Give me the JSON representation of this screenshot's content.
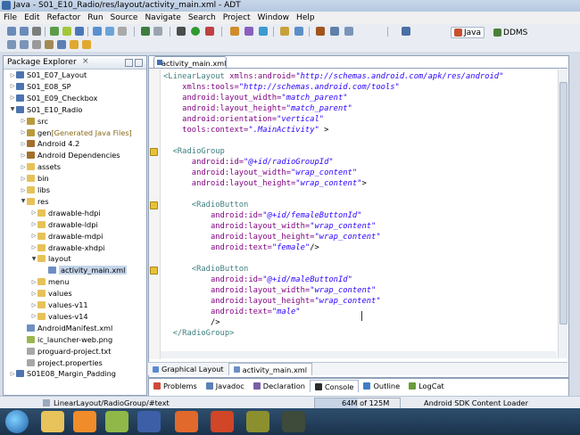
{
  "window": {
    "title": "Java - S01_E10_Radio/res/layout/activity_main.xml - ADT"
  },
  "menu": [
    "File",
    "Edit",
    "Refactor",
    "Run",
    "Source",
    "Navigate",
    "Search",
    "Project",
    "Window",
    "Help"
  ],
  "perspectives": [
    {
      "label": "Java",
      "icon": "java-perspective-icon",
      "active": true
    },
    {
      "label": "DDMS",
      "icon": "ddms-perspective-icon",
      "active": false
    }
  ],
  "package_explorer": {
    "title": "Package Explorer",
    "items": [
      {
        "label": "S01_E07_Layout",
        "icon": "project-icon",
        "expanded": false,
        "level": 0
      },
      {
        "label": "S01_E08_SP",
        "icon": "project-icon",
        "expanded": false,
        "level": 0
      },
      {
        "label": "S01_E09_Checkbox",
        "icon": "project-icon",
        "expanded": false,
        "level": 0
      },
      {
        "label": "S01_E10_Radio",
        "icon": "project-icon",
        "expanded": true,
        "level": 0
      },
      {
        "label": "src",
        "icon": "source-folder-icon",
        "expanded": false,
        "level": 1
      },
      {
        "label": "gen",
        "suffix": "[Generated Java Files]",
        "icon": "source-folder-icon",
        "expanded": false,
        "level": 1
      },
      {
        "label": "Android 4.2",
        "icon": "library-icon",
        "expanded": false,
        "level": 1
      },
      {
        "label": "Android Dependencies",
        "icon": "library-icon",
        "expanded": false,
        "level": 1
      },
      {
        "label": "assets",
        "icon": "folder-icon",
        "expanded": false,
        "level": 1
      },
      {
        "label": "bin",
        "icon": "folder-icon",
        "expanded": false,
        "level": 1
      },
      {
        "label": "libs",
        "icon": "folder-icon",
        "expanded": false,
        "level": 1
      },
      {
        "label": "res",
        "icon": "folder-icon",
        "expanded": true,
        "level": 1
      },
      {
        "label": "drawable-hdpi",
        "icon": "folder-icon",
        "expanded": false,
        "level": 2
      },
      {
        "label": "drawable-ldpi",
        "icon": "folder-icon",
        "expanded": false,
        "level": 2
      },
      {
        "label": "drawable-mdpi",
        "icon": "folder-icon",
        "expanded": false,
        "level": 2
      },
      {
        "label": "drawable-xhdpi",
        "icon": "folder-icon",
        "expanded": false,
        "level": 2
      },
      {
        "label": "layout",
        "icon": "folder-icon",
        "expanded": true,
        "level": 2
      },
      {
        "label": "activity_main.xml",
        "icon": "xml-file-icon",
        "expanded": null,
        "level": 3,
        "selected": true
      },
      {
        "label": "menu",
        "icon": "folder-icon",
        "expanded": false,
        "level": 2
      },
      {
        "label": "values",
        "icon": "folder-icon",
        "expanded": false,
        "level": 2
      },
      {
        "label": "values-v11",
        "icon": "folder-icon",
        "expanded": false,
        "level": 2
      },
      {
        "label": "values-v14",
        "icon": "folder-icon",
        "expanded": false,
        "level": 2
      },
      {
        "label": "AndroidManifest.xml",
        "icon": "xml-file-icon",
        "expanded": null,
        "level": 1
      },
      {
        "label": "ic_launcher-web.png",
        "icon": "image-file-icon",
        "expanded": null,
        "level": 1
      },
      {
        "label": "proguard-project.txt",
        "icon": "text-file-icon",
        "expanded": null,
        "level": 1
      },
      {
        "label": "project.properties",
        "icon": "text-file-icon",
        "expanded": null,
        "level": 1
      },
      {
        "label": "S01E08_Margin_Padding",
        "icon": "project-icon",
        "expanded": false,
        "level": 0
      }
    ]
  },
  "editor": {
    "tab": "activity_main.xml",
    "lines": [
      [
        [
          "tag",
          "<LinearLayout "
        ],
        [
          "att",
          "xmlns:android="
        ],
        [
          "str",
          "\"http://schemas.android.com/apk/res/android\""
        ]
      ],
      [
        [
          "att",
          "    xmlns:tools="
        ],
        [
          "str",
          "\"http://schemas.android.com/tools\""
        ]
      ],
      [
        [
          "att",
          "    android:layout_width="
        ],
        [
          "str",
          "\"match_parent\""
        ]
      ],
      [
        [
          "att",
          "    android:layout_height="
        ],
        [
          "str",
          "\"match_parent\""
        ]
      ],
      [
        [
          "att",
          "    android:orientation="
        ],
        [
          "str",
          "\"vertical\""
        ]
      ],
      [
        [
          "att",
          "    tools:context="
        ],
        [
          "str",
          "\".MainActivity\""
        ],
        [
          "plain",
          " >"
        ]
      ],
      [],
      [
        [
          "tag",
          "  <RadioGroup"
        ]
      ],
      [
        [
          "att",
          "      android:id="
        ],
        [
          "str",
          "\"@+id/radioGroupId\""
        ]
      ],
      [
        [
          "att",
          "      android:layout_width="
        ],
        [
          "str",
          "\"wrap_content\""
        ]
      ],
      [
        [
          "att",
          "      android:layout_height="
        ],
        [
          "str",
          "\"wrap_content\""
        ],
        [
          "plain",
          ">"
        ]
      ],
      [],
      [
        [
          "tag",
          "      <RadioButton"
        ]
      ],
      [
        [
          "att",
          "          android:id="
        ],
        [
          "str",
          "\"@+id/femaleButtonId\""
        ]
      ],
      [
        [
          "att",
          "          android:layout_width="
        ],
        [
          "str",
          "\"wrap_content\""
        ]
      ],
      [
        [
          "att",
          "          android:layout_height="
        ],
        [
          "str",
          "\"wrap_content\""
        ]
      ],
      [
        [
          "att",
          "          android:text="
        ],
        [
          "str",
          "\"female\""
        ],
        [
          "plain",
          "/>"
        ]
      ],
      [],
      [
        [
          "tag",
          "      <RadioButton"
        ]
      ],
      [
        [
          "att",
          "          android:id="
        ],
        [
          "str",
          "\"@+id/maleButtonId\""
        ]
      ],
      [
        [
          "att",
          "          android:layout_width="
        ],
        [
          "str",
          "\"wrap_content\""
        ]
      ],
      [
        [
          "att",
          "          android:layout_height="
        ],
        [
          "str",
          "\"wrap_content\""
        ]
      ],
      [
        [
          "att",
          "          android:text="
        ],
        [
          "str",
          "\"male\""
        ]
      ],
      [
        [
          "plain",
          "          />"
        ]
      ],
      [
        [
          "tag",
          "  </RadioGroup>"
        ]
      ]
    ],
    "bottom_tabs": [
      {
        "label": "Graphical Layout",
        "icon": "graphical-layout-icon",
        "active": false
      },
      {
        "label": "activity_main.xml",
        "icon": "xml-file-icon",
        "active": true
      }
    ]
  },
  "console_tabs": [
    {
      "label": "Problems",
      "icon": "problems-icon"
    },
    {
      "label": "Javadoc",
      "icon": "javadoc-icon"
    },
    {
      "label": "Declaration",
      "icon": "declaration-icon"
    },
    {
      "label": "Console",
      "icon": "console-icon",
      "active": true
    },
    {
      "label": "Outline",
      "icon": "outline-icon"
    },
    {
      "label": "LogCat",
      "icon": "logcat-icon"
    }
  ],
  "status_bar": {
    "path": "LinearLayout/RadioGroup/#text",
    "heap": "64M of 125M",
    "heap_fraction": 0.51,
    "task": "Android SDK Content Loader"
  },
  "taskbar": {
    "apps": [
      "explorer-icon",
      "media-player-icon",
      "android-icon",
      "firefox-icon",
      "powerpoint-icon",
      "eclipse-icon",
      "terminal-icon"
    ]
  },
  "colors": {
    "xml_tag": "#3f7f7f",
    "xml_attr": "#7f007f",
    "xml_string": "#2a00ff",
    "selection": "#c5d5ea"
  }
}
